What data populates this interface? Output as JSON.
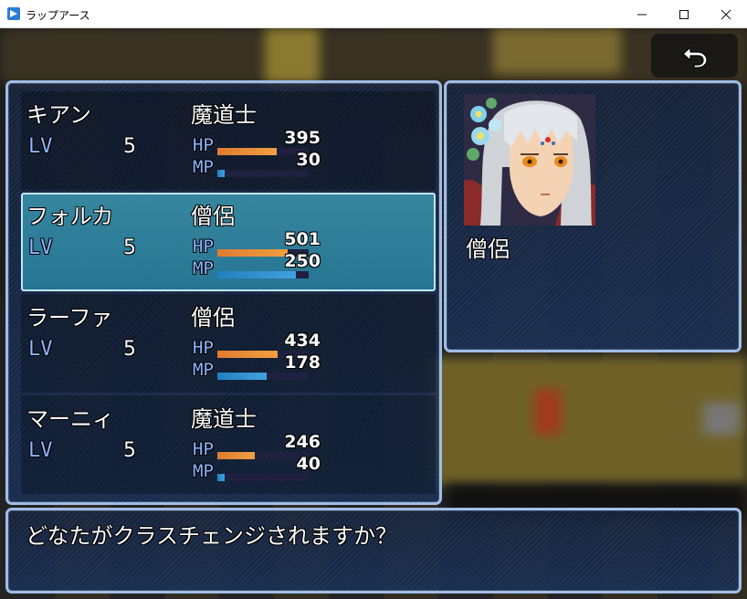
{
  "window": {
    "title": "ラップアース",
    "minimize_label": "—",
    "maximize_label": "☐",
    "close_label": "✕"
  },
  "back_button": {
    "icon": "undo-arrow-icon"
  },
  "actors": [
    {
      "name": "キアン",
      "class": "魔道士",
      "lv_label": "LV",
      "level": "5",
      "hp_label": "HP",
      "hp": "395",
      "hp_ratio": 0.65,
      "mp_label": "MP",
      "mp": "30",
      "mp_ratio": 0.08,
      "selected": false
    },
    {
      "name": "フォルカ",
      "class": "僧侶",
      "lv_label": "LV",
      "level": "5",
      "hp_label": "HP",
      "hp": "501",
      "hp_ratio": 0.77,
      "mp_label": "MP",
      "mp": "250",
      "mp_ratio": 0.86,
      "selected": true
    },
    {
      "name": "ラーファ",
      "class": "僧侶",
      "lv_label": "LV",
      "level": "5",
      "hp_label": "HP",
      "hp": "434",
      "hp_ratio": 0.66,
      "mp_label": "MP",
      "mp": "178",
      "mp_ratio": 0.54,
      "selected": false
    },
    {
      "name": "マーニィ",
      "class": "魔道士",
      "lv_label": "LV",
      "level": "5",
      "hp_label": "HP",
      "hp": "246",
      "hp_ratio": 0.41,
      "mp_label": "MP",
      "mp": "40",
      "mp_ratio": 0.08,
      "selected": false
    }
  ],
  "detail": {
    "class_name": "僧侶"
  },
  "help": {
    "text": "どなたがクラスチェンジされますか？"
  },
  "colors": {
    "hp_gauge": "#f0a040",
    "mp_gauge": "#40a0e0",
    "window_border": "#9fbde6",
    "param_label": "#8fb4ff"
  }
}
